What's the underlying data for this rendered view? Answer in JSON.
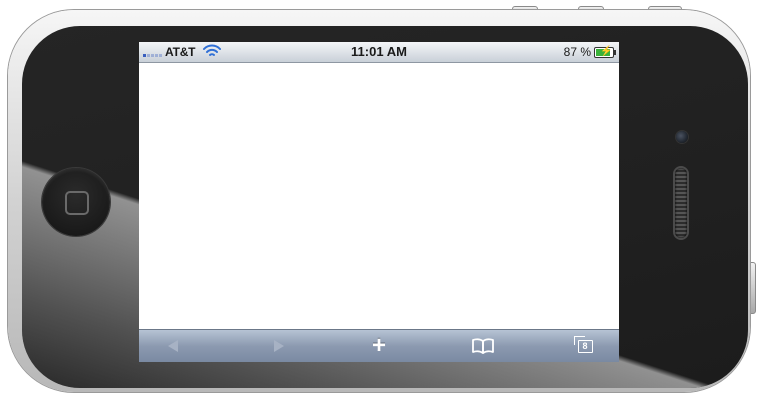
{
  "status_bar": {
    "carrier": "AT&T",
    "time": "11:01 AM",
    "battery_percent_text": "87 %",
    "battery_level": 0.87,
    "signal_bars": 5,
    "signal_bars_active": 1,
    "wifi_icon": "wifi-icon",
    "charging_icon": "charging-bolt-icon"
  },
  "toolbar": {
    "back_icon": "back-arrow-icon",
    "forward_icon": "forward-arrow-icon",
    "add_icon": "plus-icon",
    "add_label": "+",
    "bookmarks_icon": "bookmarks-book-icon",
    "pages_icon": "pages-icon",
    "pages_count": "8"
  },
  "colors": {
    "bezel": "#202020",
    "status_bar_top": "#f4f6f8",
    "toolbar": "#8c9ab0",
    "toolbar_disabled_icon": "#a7b2c4",
    "toolbar_icon": "#ffffff",
    "battery_fill": "#3ab23a",
    "signal_blue": "#3a5fbf"
  }
}
